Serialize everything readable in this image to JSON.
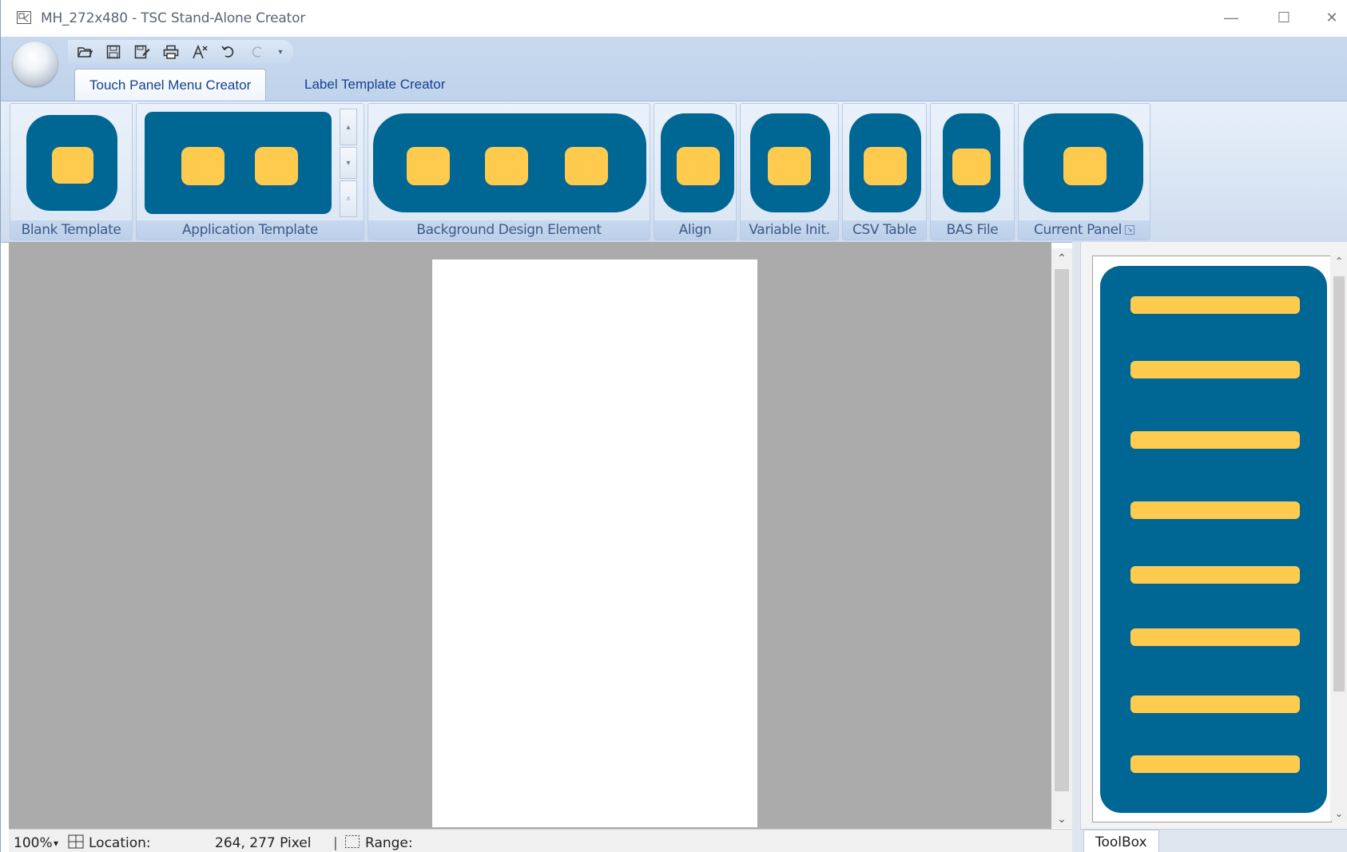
{
  "window": {
    "title": "MH_272x480 - TSC Stand-Alone Creator",
    "controls": {
      "minimize": "—",
      "maximize": "☐",
      "close": "✕"
    }
  },
  "quick_access": [
    {
      "name": "open-icon"
    },
    {
      "name": "save-icon"
    },
    {
      "name": "save-as-icon"
    },
    {
      "name": "print-icon"
    },
    {
      "name": "clear-format-icon"
    },
    {
      "name": "undo-icon"
    },
    {
      "name": "redo-icon"
    }
  ],
  "tabs": {
    "touch_panel": "Touch Panel Menu Creator",
    "label_template": "Label Template Creator"
  },
  "ribbon_groups": {
    "blank_template": "Blank Template",
    "application_template": "Application Template",
    "background_design": "Background Design Element",
    "align": "Align",
    "variable_init": "Variable Init.",
    "csv_table": "CSV Table",
    "bas_file": "BAS File",
    "current_panel": "Current Panel"
  },
  "colors": {
    "placeholder_blue": "#006694",
    "placeholder_yellow": "#ffcb4f"
  },
  "statusbar": {
    "zoom": "100%",
    "location_label": "Location:",
    "location_value": "264, 277 Pixel",
    "range_label": "Range:"
  },
  "toolbox": {
    "tab_label": "ToolBox"
  }
}
